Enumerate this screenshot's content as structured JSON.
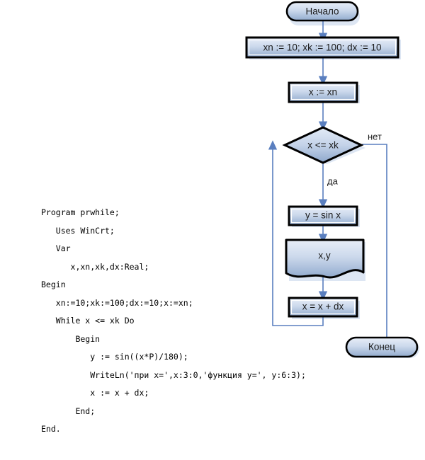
{
  "diagram": {
    "title": "",
    "colors": {
      "fill_top": "#dfe7f3",
      "fill_bottom": "#8fa9cc",
      "border": "#000000",
      "connector": "#5a7fbf",
      "shadow": "#dde5f2",
      "text": "#1a1a1a"
    },
    "nodes": [
      {
        "id": "start",
        "shape": "terminator",
        "label": "Начало"
      },
      {
        "id": "init",
        "shape": "process",
        "label": "xn := 10; xk := 100; dx :=  10"
      },
      {
        "id": "assign",
        "shape": "process",
        "label": "x := xn"
      },
      {
        "id": "cond",
        "shape": "decision",
        "label": "x <= xk"
      },
      {
        "id": "calc",
        "shape": "process",
        "label": "y = sin x"
      },
      {
        "id": "output",
        "shape": "document",
        "label": "x,y"
      },
      {
        "id": "step",
        "shape": "process",
        "label": "x = x + dx"
      },
      {
        "id": "end",
        "shape": "terminator",
        "label": "Конец"
      }
    ],
    "edge_labels": {
      "yes": "да",
      "no": "нет"
    }
  },
  "code": {
    "language": "Pascal",
    "lines": [
      "Program prwhile;",
      "   Uses WinCrt;",
      "   Var",
      "      x,xn,xk,dx:Real;",
      "Begin",
      "   xn:=10;xk:=100;dx:=10;x:=xn;",
      "   While x <= xk Do",
      "       Begin",
      "          y := sin((x*P)/180);",
      "          WriteLn('при x=',x:3:0,'функция y=', y:6:3);",
      "          x := x + dx;",
      "       End;",
      "End."
    ]
  }
}
